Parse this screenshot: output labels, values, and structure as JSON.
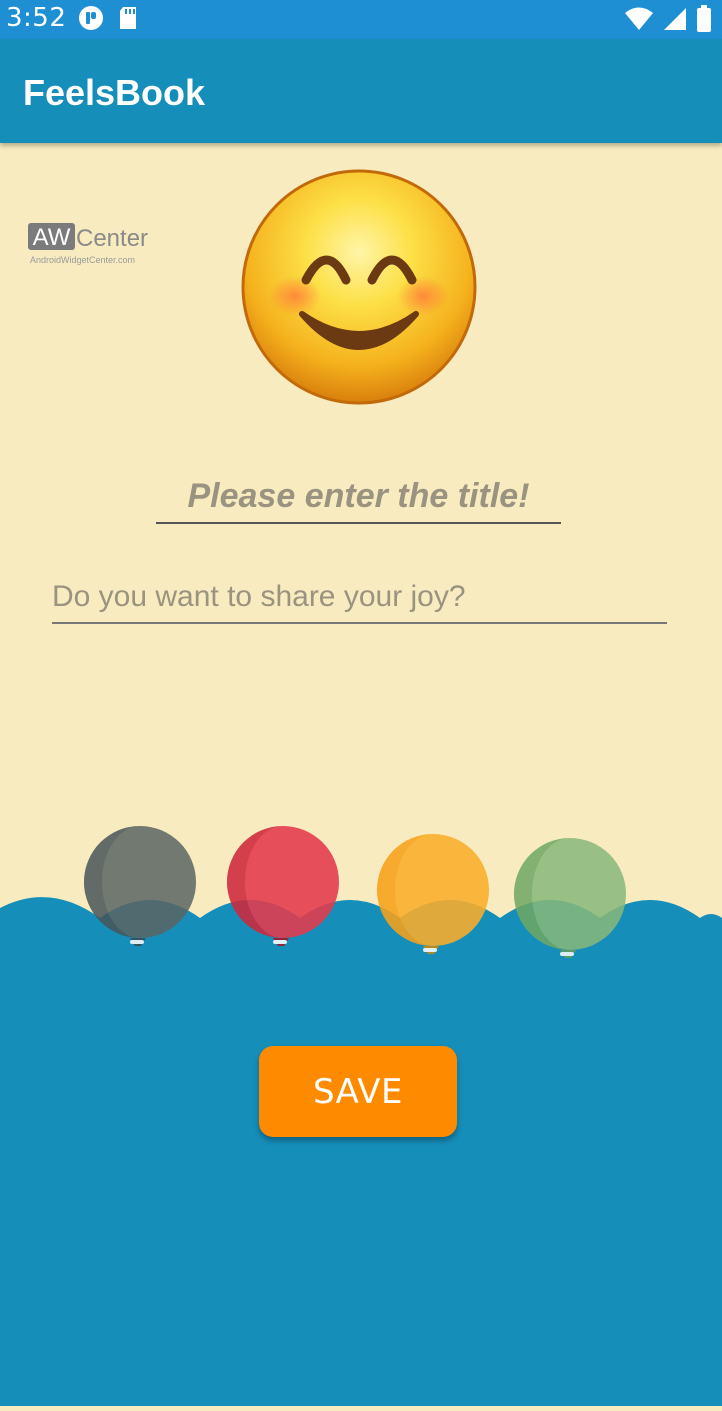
{
  "status_bar": {
    "time": "3:52",
    "icons": [
      "app-notification-icon",
      "sd-card-icon",
      "wifi-icon",
      "cell-signal-icon",
      "battery-icon"
    ]
  },
  "app_bar": {
    "title": "FeelsBook"
  },
  "logo": {
    "text_mark": "AW",
    "text_word": "Center",
    "text_sub": "AndroidWidgetCenter.com"
  },
  "emoji": {
    "name": "smiling-face-icon"
  },
  "form": {
    "title_placeholder": "Please enter the title!",
    "title_value": "",
    "body_placeholder": "Do you want to share your joy?",
    "body_value": ""
  },
  "balloons": [
    {
      "name": "balloon-gray-icon",
      "color": "#5b6664"
    },
    {
      "name": "balloon-red-icon",
      "color": "#e43a4d"
    },
    {
      "name": "balloon-yellow-icon",
      "color": "#fbae2a"
    },
    {
      "name": "balloon-green-icon",
      "color": "#88b97a"
    }
  ],
  "actions": {
    "save_label": "SAVE"
  },
  "colors": {
    "status_bar": "#1f8fd3",
    "app_bar": "#168eba",
    "background": "#f8ebc0",
    "water": "#168eba",
    "save_button": "#fe8a00"
  }
}
